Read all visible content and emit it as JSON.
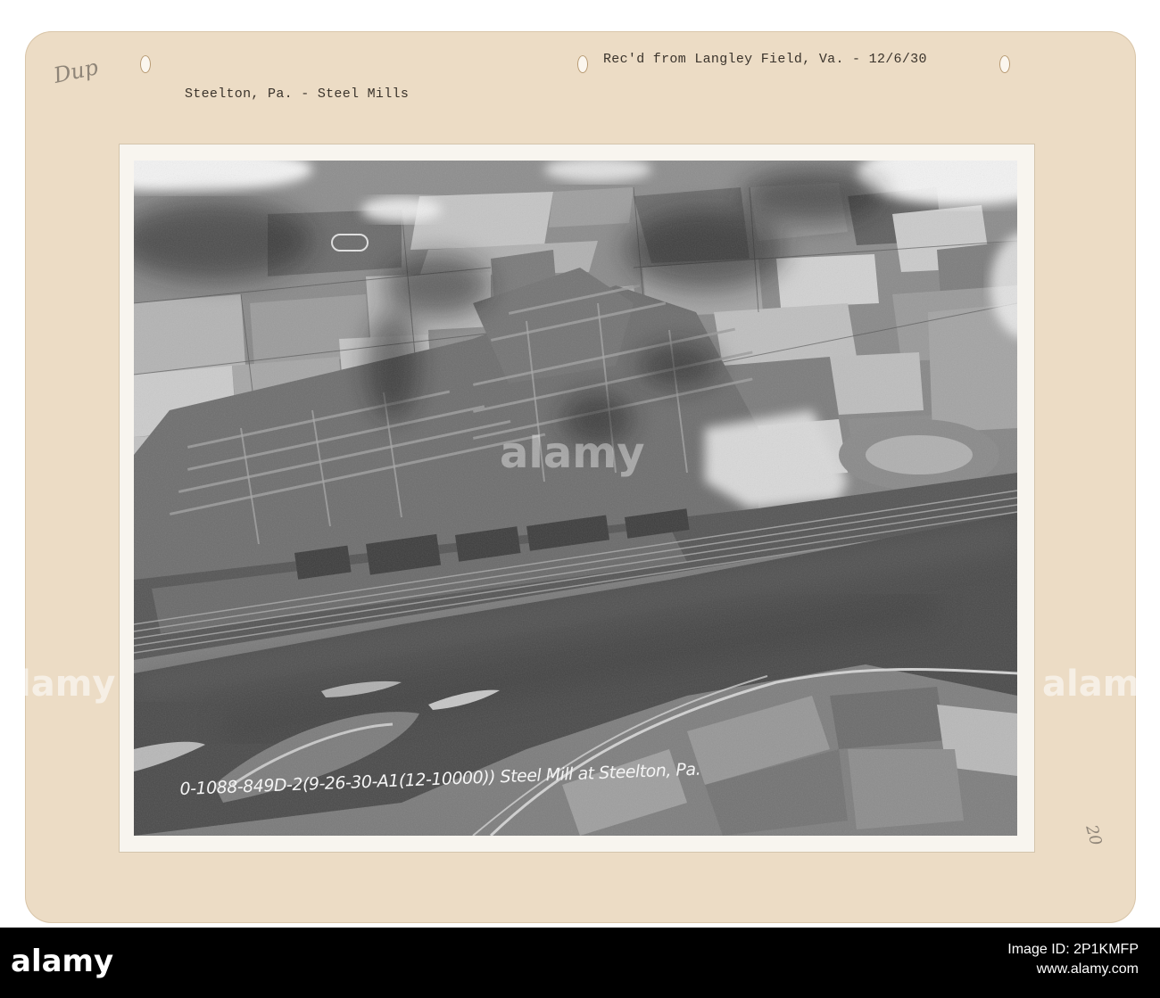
{
  "card": {
    "header_right": "Rec'd from Langley Field, Va. - 12/6/30",
    "header_left": "Steelton, Pa. - Steel Mills",
    "pencil_corner": "Dup",
    "pencil_number": "20"
  },
  "photo": {
    "caption": "0-1088-849D-2(9-26-30-A1(12-10000)) Steel Mill at Steelton, Pa."
  },
  "watermark": {
    "text": "alamy"
  },
  "footer": {
    "logo": "alamy",
    "image_id_label": "Image ID: 2P1KMFP",
    "site": "www.alamy.com"
  }
}
